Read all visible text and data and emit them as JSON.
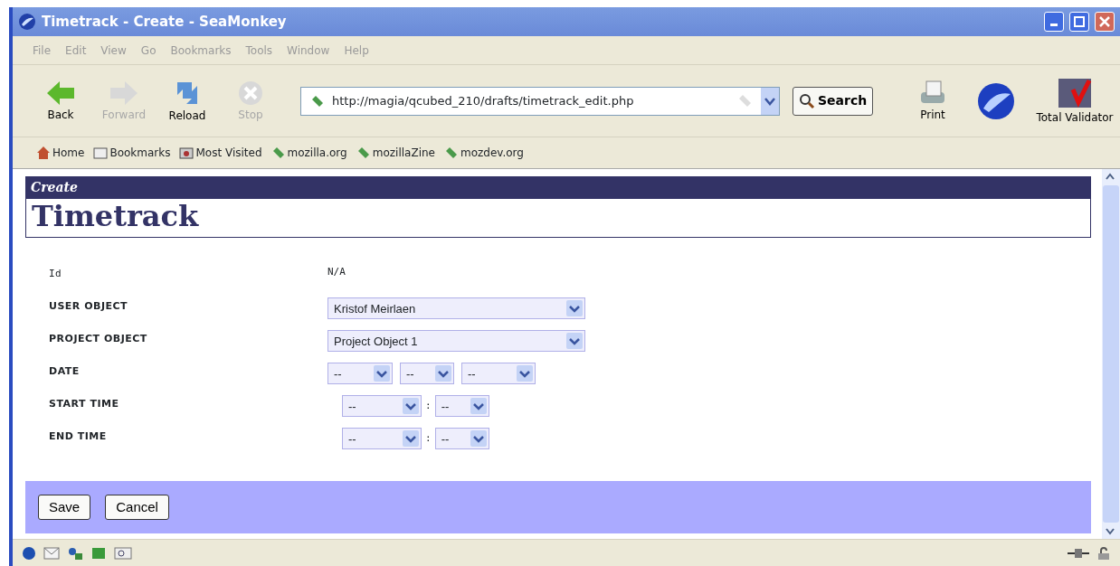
{
  "window": {
    "title": "Timetrack - Create - SeaMonkey"
  },
  "menu": [
    "File",
    "Edit",
    "View",
    "Go",
    "Bookmarks",
    "Tools",
    "Window",
    "Help"
  ],
  "toolbar": [
    {
      "label": "Back",
      "kind": "back",
      "disabled": false
    },
    {
      "label": "Forward",
      "kind": "forward",
      "disabled": true
    },
    {
      "label": "Reload",
      "kind": "reload",
      "disabled": false
    },
    {
      "label": "Stop",
      "kind": "stop",
      "disabled": true
    }
  ],
  "address": {
    "value": "http://magia/qcubed_210/drafts/timetrack_edit.php"
  },
  "search_button": "Search",
  "right_tools": [
    {
      "label": "Print",
      "kind": "print"
    },
    {
      "kind": "logo"
    },
    {
      "label": "Total Validator",
      "kind": "validator"
    }
  ],
  "bookmarks": [
    {
      "label": "Home",
      "kind": "home"
    },
    {
      "label": "Bookmarks",
      "kind": "folder"
    },
    {
      "label": "Most Visited",
      "kind": "smart"
    },
    {
      "label": "mozilla.org",
      "kind": "link"
    },
    {
      "label": "mozillaZine",
      "kind": "link"
    },
    {
      "label": "mozdev.org",
      "kind": "link"
    }
  ],
  "page": {
    "subtitle": "Create",
    "title": "Timetrack",
    "fields": [
      {
        "label": "Id",
        "kind": "text",
        "value": "N/A"
      },
      {
        "label": "USER OBJECT",
        "kind": "select",
        "value": "Kristof Meirlaen"
      },
      {
        "label": "PROJECT OBJECT",
        "kind": "select",
        "value": "Project Object 1"
      },
      {
        "label": "DATE",
        "kind": "date",
        "parts": [
          "--",
          "--",
          "--"
        ]
      },
      {
        "label": "START TIME",
        "kind": "time",
        "parts": [
          "--",
          "--"
        ],
        "separator": ":"
      },
      {
        "label": "END TIME",
        "kind": "time",
        "parts": [
          "--",
          "--"
        ],
        "separator": ":"
      }
    ],
    "buttons": [
      "Save",
      "Cancel"
    ]
  }
}
